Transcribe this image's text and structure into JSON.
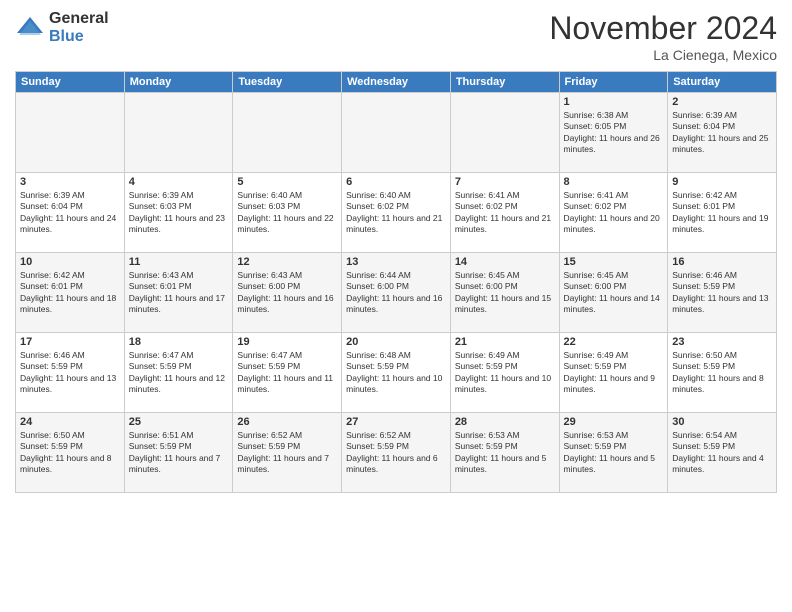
{
  "logo": {
    "general": "General",
    "blue": "Blue"
  },
  "title": "November 2024",
  "location": "La Cienega, Mexico",
  "weekdays": [
    "Sunday",
    "Monday",
    "Tuesday",
    "Wednesday",
    "Thursday",
    "Friday",
    "Saturday"
  ],
  "weeks": [
    [
      {
        "day": "",
        "info": ""
      },
      {
        "day": "",
        "info": ""
      },
      {
        "day": "",
        "info": ""
      },
      {
        "day": "",
        "info": ""
      },
      {
        "day": "",
        "info": ""
      },
      {
        "day": "1",
        "info": "Sunrise: 6:38 AM\nSunset: 6:05 PM\nDaylight: 11 hours and 26 minutes."
      },
      {
        "day": "2",
        "info": "Sunrise: 6:39 AM\nSunset: 6:04 PM\nDaylight: 11 hours and 25 minutes."
      }
    ],
    [
      {
        "day": "3",
        "info": "Sunrise: 6:39 AM\nSunset: 6:04 PM\nDaylight: 11 hours and 24 minutes."
      },
      {
        "day": "4",
        "info": "Sunrise: 6:39 AM\nSunset: 6:03 PM\nDaylight: 11 hours and 23 minutes."
      },
      {
        "day": "5",
        "info": "Sunrise: 6:40 AM\nSunset: 6:03 PM\nDaylight: 11 hours and 22 minutes."
      },
      {
        "day": "6",
        "info": "Sunrise: 6:40 AM\nSunset: 6:02 PM\nDaylight: 11 hours and 21 minutes."
      },
      {
        "day": "7",
        "info": "Sunrise: 6:41 AM\nSunset: 6:02 PM\nDaylight: 11 hours and 21 minutes."
      },
      {
        "day": "8",
        "info": "Sunrise: 6:41 AM\nSunset: 6:02 PM\nDaylight: 11 hours and 20 minutes."
      },
      {
        "day": "9",
        "info": "Sunrise: 6:42 AM\nSunset: 6:01 PM\nDaylight: 11 hours and 19 minutes."
      }
    ],
    [
      {
        "day": "10",
        "info": "Sunrise: 6:42 AM\nSunset: 6:01 PM\nDaylight: 11 hours and 18 minutes."
      },
      {
        "day": "11",
        "info": "Sunrise: 6:43 AM\nSunset: 6:01 PM\nDaylight: 11 hours and 17 minutes."
      },
      {
        "day": "12",
        "info": "Sunrise: 6:43 AM\nSunset: 6:00 PM\nDaylight: 11 hours and 16 minutes."
      },
      {
        "day": "13",
        "info": "Sunrise: 6:44 AM\nSunset: 6:00 PM\nDaylight: 11 hours and 16 minutes."
      },
      {
        "day": "14",
        "info": "Sunrise: 6:45 AM\nSunset: 6:00 PM\nDaylight: 11 hours and 15 minutes."
      },
      {
        "day": "15",
        "info": "Sunrise: 6:45 AM\nSunset: 6:00 PM\nDaylight: 11 hours and 14 minutes."
      },
      {
        "day": "16",
        "info": "Sunrise: 6:46 AM\nSunset: 5:59 PM\nDaylight: 11 hours and 13 minutes."
      }
    ],
    [
      {
        "day": "17",
        "info": "Sunrise: 6:46 AM\nSunset: 5:59 PM\nDaylight: 11 hours and 13 minutes."
      },
      {
        "day": "18",
        "info": "Sunrise: 6:47 AM\nSunset: 5:59 PM\nDaylight: 11 hours and 12 minutes."
      },
      {
        "day": "19",
        "info": "Sunrise: 6:47 AM\nSunset: 5:59 PM\nDaylight: 11 hours and 11 minutes."
      },
      {
        "day": "20",
        "info": "Sunrise: 6:48 AM\nSunset: 5:59 PM\nDaylight: 11 hours and 10 minutes."
      },
      {
        "day": "21",
        "info": "Sunrise: 6:49 AM\nSunset: 5:59 PM\nDaylight: 11 hours and 10 minutes."
      },
      {
        "day": "22",
        "info": "Sunrise: 6:49 AM\nSunset: 5:59 PM\nDaylight: 11 hours and 9 minutes."
      },
      {
        "day": "23",
        "info": "Sunrise: 6:50 AM\nSunset: 5:59 PM\nDaylight: 11 hours and 8 minutes."
      }
    ],
    [
      {
        "day": "24",
        "info": "Sunrise: 6:50 AM\nSunset: 5:59 PM\nDaylight: 11 hours and 8 minutes."
      },
      {
        "day": "25",
        "info": "Sunrise: 6:51 AM\nSunset: 5:59 PM\nDaylight: 11 hours and 7 minutes."
      },
      {
        "day": "26",
        "info": "Sunrise: 6:52 AM\nSunset: 5:59 PM\nDaylight: 11 hours and 7 minutes."
      },
      {
        "day": "27",
        "info": "Sunrise: 6:52 AM\nSunset: 5:59 PM\nDaylight: 11 hours and 6 minutes."
      },
      {
        "day": "28",
        "info": "Sunrise: 6:53 AM\nSunset: 5:59 PM\nDaylight: 11 hours and 5 minutes."
      },
      {
        "day": "29",
        "info": "Sunrise: 6:53 AM\nSunset: 5:59 PM\nDaylight: 11 hours and 5 minutes."
      },
      {
        "day": "30",
        "info": "Sunrise: 6:54 AM\nSunset: 5:59 PM\nDaylight: 11 hours and 4 minutes."
      }
    ]
  ]
}
